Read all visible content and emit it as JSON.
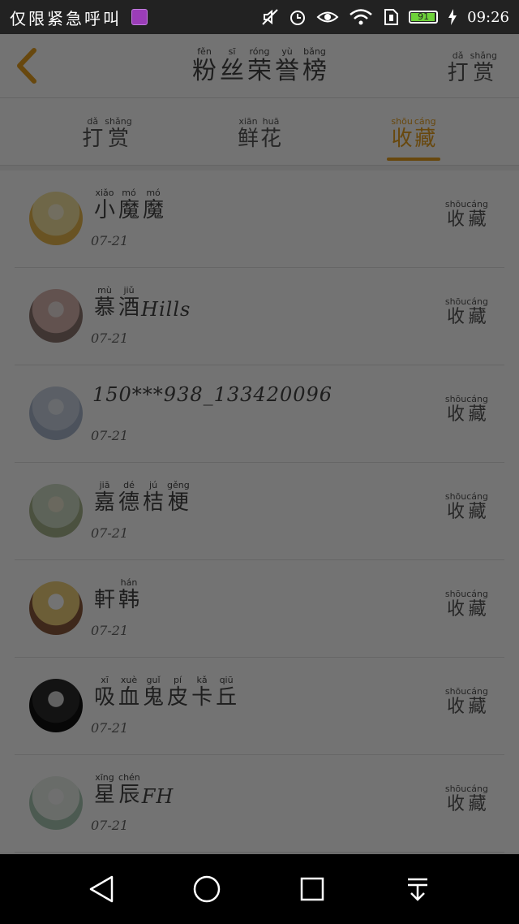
{
  "status_bar": {
    "carrier": "仅限紧急呼叫",
    "battery_level": "91",
    "time": "09:26",
    "icons": [
      "gallery-icon",
      "mute-icon",
      "alarm-icon",
      "eye-icon",
      "wifi-icon",
      "sim-icon",
      "battery-icon",
      "charging-icon"
    ]
  },
  "header": {
    "title": [
      {
        "c": "粉",
        "p": "fěn"
      },
      {
        "c": "丝",
        "p": "sī"
      },
      {
        "c": "荣",
        "p": "róng"
      },
      {
        "c": "誉",
        "p": "yù"
      },
      {
        "c": "榜",
        "p": "bǎng"
      }
    ],
    "reward": [
      {
        "c": "打",
        "p": "dǎ"
      },
      {
        "c": "赏",
        "p": "shǎng"
      }
    ]
  },
  "tabs": [
    {
      "chars": [
        {
          "c": "打",
          "p": "dǎ"
        },
        {
          "c": "赏",
          "p": "shǎng"
        }
      ],
      "active": false
    },
    {
      "chars": [
        {
          "c": "鲜",
          "p": "xiān"
        },
        {
          "c": "花",
          "p": "huā"
        }
      ],
      "active": false
    },
    {
      "chars": [
        {
          "c": "收",
          "p": "shōu"
        },
        {
          "c": "藏",
          "p": "cáng"
        }
      ],
      "active": true
    }
  ],
  "list": [
    {
      "name": [
        {
          "c": "小",
          "p": "xiǎo"
        },
        {
          "c": "魔",
          "p": "mó"
        },
        {
          "c": "魔",
          "p": "mó"
        }
      ],
      "latin": "",
      "date": "07-21",
      "avatar": [
        "#f6e4a0",
        "#e9b94e",
        "#fdf3d6"
      ]
    },
    {
      "name": [
        {
          "c": "慕",
          "p": "mù"
        },
        {
          "c": "酒",
          "p": "jiǔ"
        }
      ],
      "latin": "Hills",
      "date": "07-21",
      "avatar": [
        "#d9b5b0",
        "#8d7570",
        "#ede3e0"
      ]
    },
    {
      "name": [],
      "latin": "150***938_133420096",
      "date": "07-21",
      "avatar": [
        "#c9d3e2",
        "#a9b7cc",
        "#e6ebf2"
      ]
    },
    {
      "name": [
        {
          "c": "嘉",
          "p": "jiā"
        },
        {
          "c": "德",
          "p": "dé"
        },
        {
          "c": "桔",
          "p": "jú"
        },
        {
          "c": "梗",
          "p": "gěng"
        }
      ],
      "latin": "",
      "date": "07-21",
      "avatar": [
        "#cfdcc6",
        "#a6b38c",
        "#ece7d0"
      ]
    },
    {
      "name": [
        {
          "c": "軒",
          "p": ""
        },
        {
          "c": "韩",
          "p": "hán"
        }
      ],
      "latin": "",
      "date": "07-21",
      "avatar": [
        "#f0d07a",
        "#8b5a3c",
        "#fff"
      ]
    },
    {
      "name": [
        {
          "c": "吸",
          "p": "xī"
        },
        {
          "c": "血",
          "p": "xuè"
        },
        {
          "c": "鬼",
          "p": "guǐ"
        },
        {
          "c": "皮",
          "p": "pí"
        },
        {
          "c": "卡",
          "p": "kǎ"
        },
        {
          "c": "丘",
          "p": "qiū"
        }
      ],
      "latin": "",
      "date": "07-21",
      "avatar": [
        "#2a2a2a",
        "#111",
        "#d8d8d8"
      ]
    },
    {
      "name": [
        {
          "c": "星",
          "p": "xīng"
        },
        {
          "c": "辰",
          "p": "chén"
        }
      ],
      "latin": "FH",
      "date": "07-21",
      "avatar": [
        "#e8f0e8",
        "#a8c8b4",
        "#f6f6f6"
      ]
    }
  ],
  "favorite_label": [
    {
      "c": "收",
      "p": "shōu"
    },
    {
      "c": "藏",
      "p": "cáng"
    }
  ],
  "nav": [
    "back-triangle-icon",
    "home-circle-icon",
    "recents-square-icon",
    "pull-down-icon"
  ]
}
